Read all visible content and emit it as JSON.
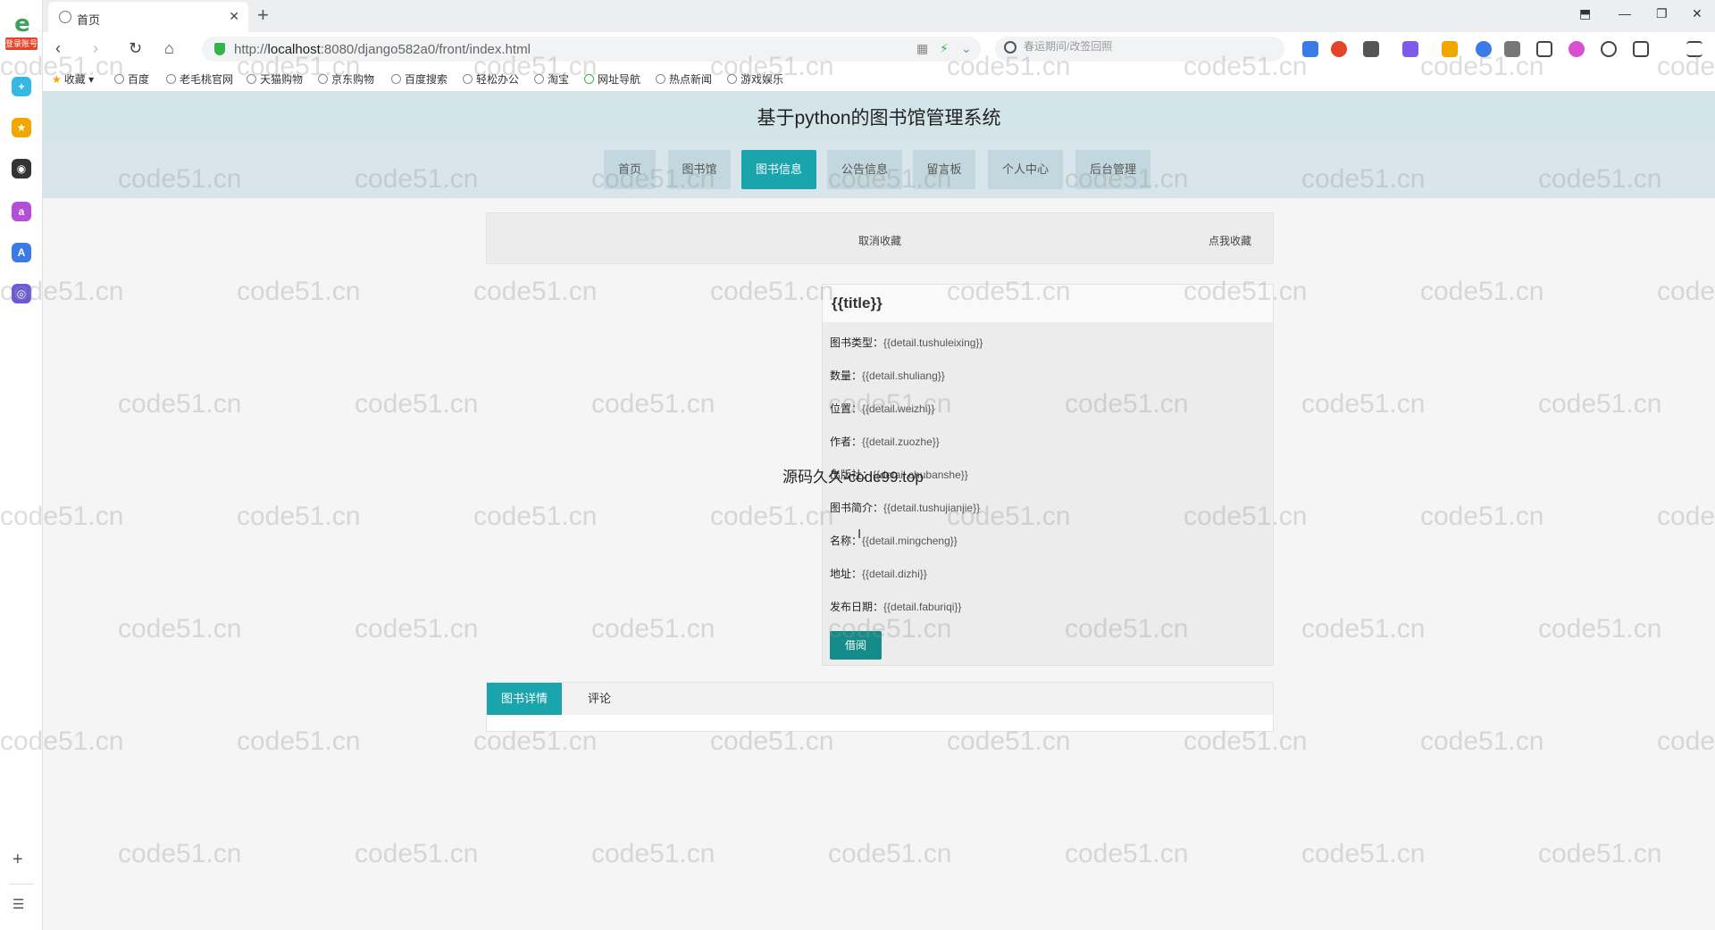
{
  "browser": {
    "sidebar_login_badge": "登录账号",
    "tab_title": "首页",
    "url_prefix": "http://",
    "url_host": "localhost",
    "url_rest": ":8080/django582a0/front/index.html",
    "search_placeholder": "春运期间/改签回照",
    "bookmarks": [
      "收藏",
      "百度",
      "老毛桃官网",
      "天猫购物",
      "京东购物",
      "百度搜索",
      "轻松办公",
      "淘宝",
      "网址导航",
      "热点新闻",
      "游戏娱乐"
    ]
  },
  "site": {
    "title": "基于python的图书馆管理系统",
    "nav": [
      {
        "label": "首页",
        "active": false
      },
      {
        "label": "图书馆",
        "active": false
      },
      {
        "label": "图书信息",
        "active": true
      },
      {
        "label": "公告信息",
        "active": false
      },
      {
        "label": "留言板",
        "active": false
      },
      {
        "label": "个人中心",
        "active": false
      },
      {
        "label": "后台管理",
        "active": false
      }
    ],
    "favorite": {
      "cancel": "取消收藏",
      "add": "点我收藏"
    },
    "detail": {
      "title": "{{title}}",
      "fields": [
        {
          "label": "图书类型：",
          "value": "{{detail.tushuleixing}}"
        },
        {
          "label": "数量：",
          "value": "{{detail.shuliang}}"
        },
        {
          "label": "位置：",
          "value": "{{detail.weizhi}}"
        },
        {
          "label": "作者：",
          "value": "{{detail.zuozhe}}"
        },
        {
          "label": "出版社：",
          "value": "{{detail.chubanshe}}"
        },
        {
          "label": "图书简介：",
          "value": "{{detail.tushujianjie}}"
        },
        {
          "label": "名称：",
          "value": "{{detail.mingcheng}}"
        },
        {
          "label": "地址：",
          "value": "{{detail.dizhi}}"
        },
        {
          "label": "发布日期：",
          "value": "{{detail.faburiqi}}"
        }
      ],
      "borrow": "借阅"
    },
    "tabs": [
      {
        "label": "图书详情",
        "active": true
      },
      {
        "label": "评论",
        "active": false
      }
    ]
  },
  "overlay_text": "源码久久-code99.top",
  "watermark": "code51.cn",
  "colors": {
    "accent": "#1aa5ad",
    "header_bg": "#d4e5ea",
    "borrow": "#138c8a"
  }
}
